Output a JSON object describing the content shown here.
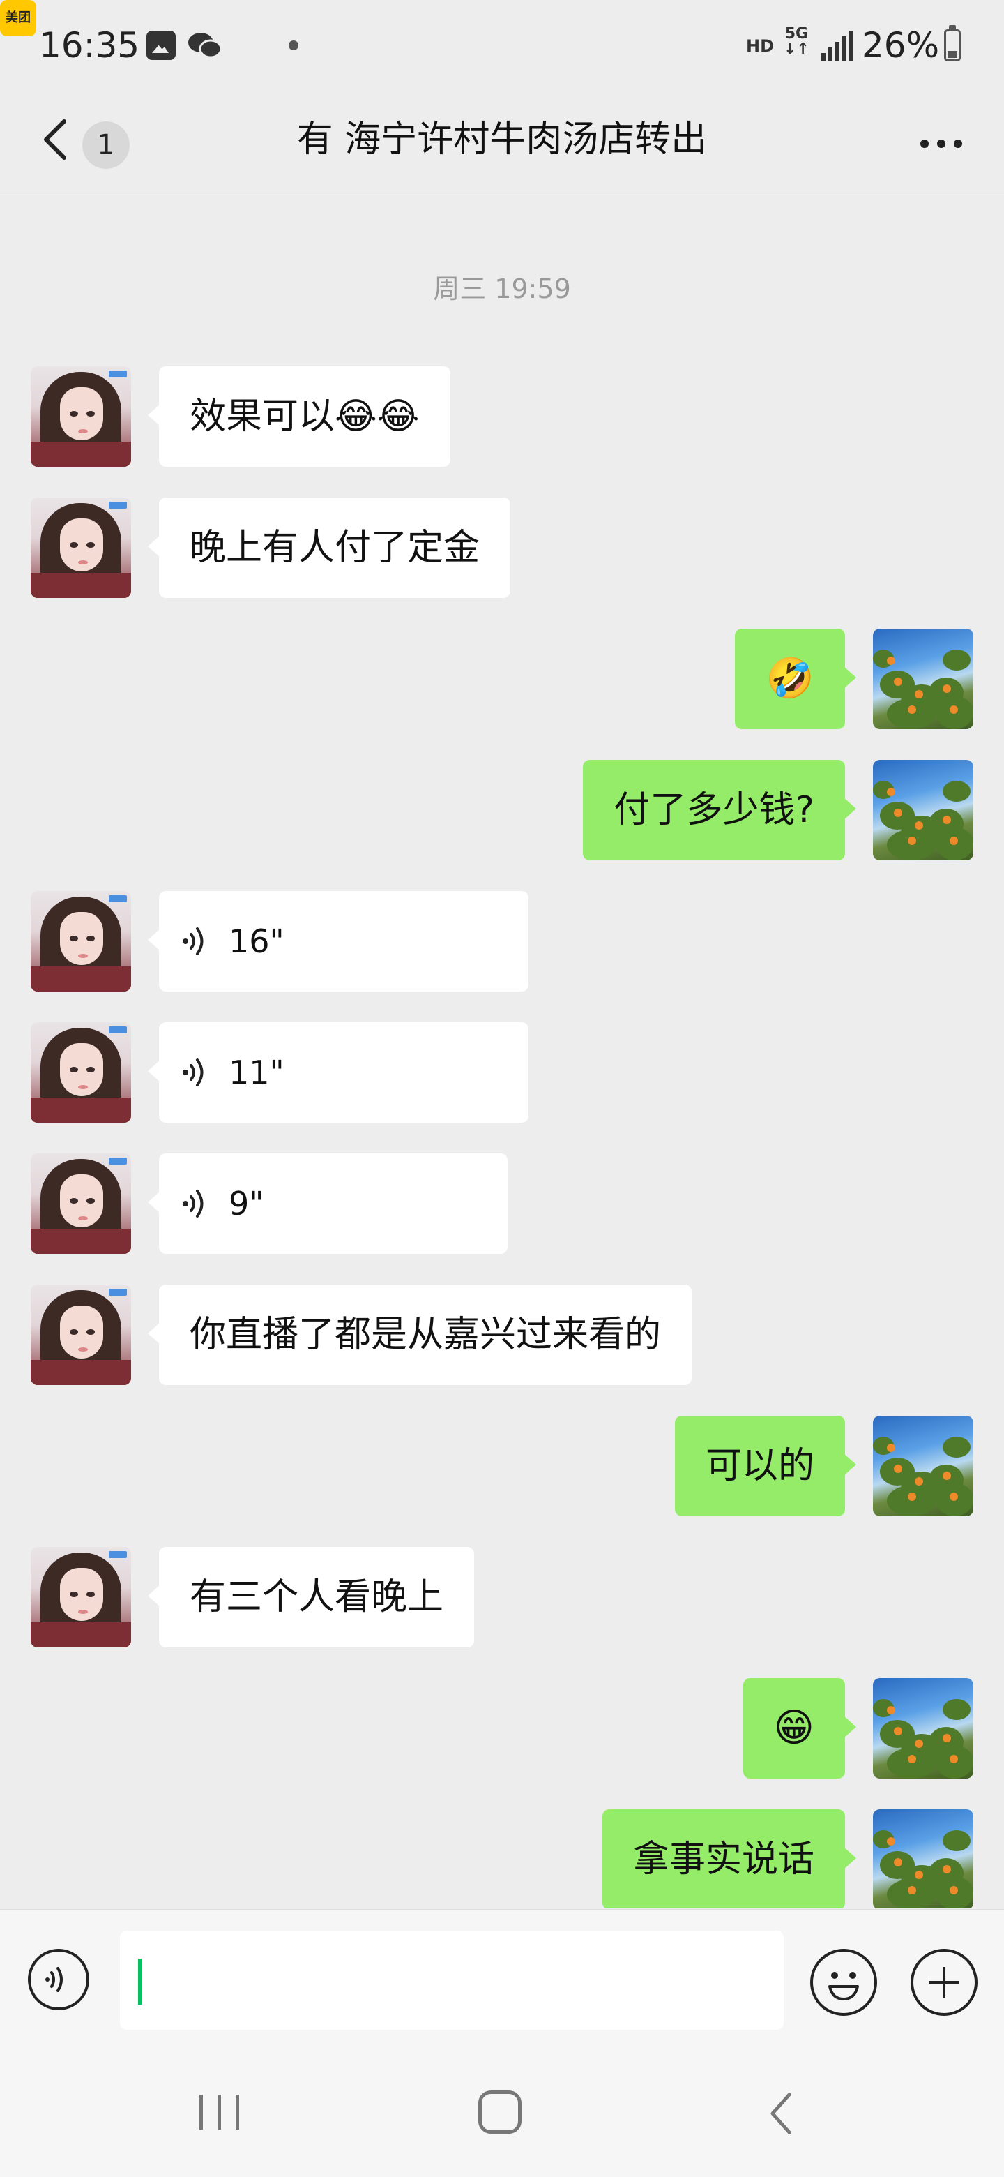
{
  "status_bar": {
    "time": "16:35",
    "meituan_label": "美团",
    "network_hd": "HD",
    "network_5g": "5G",
    "battery_percent": "26%",
    "battery_level": 0.26
  },
  "nav": {
    "back_badge": "1",
    "title": "有 海宁许村牛肉汤店转出"
  },
  "chat": {
    "timestamp": "周三 19:59",
    "messages": [
      {
        "side": "left",
        "type": "text",
        "text": "效果可以😂😂"
      },
      {
        "side": "left",
        "type": "text",
        "text": "晚上有人付了定金"
      },
      {
        "side": "right",
        "type": "emoji",
        "text": "🤣"
      },
      {
        "side": "right",
        "type": "text",
        "text": "付了多少钱?"
      },
      {
        "side": "left",
        "type": "voice",
        "text": "16\""
      },
      {
        "side": "left",
        "type": "voice",
        "text": "11\""
      },
      {
        "side": "left",
        "type": "voice",
        "text": "9\""
      },
      {
        "side": "left",
        "type": "text",
        "text": "你直播了都是从嘉兴过来看的"
      },
      {
        "side": "right",
        "type": "text",
        "text": "可以的"
      },
      {
        "side": "left",
        "type": "text",
        "text": "有三个人看晚上"
      },
      {
        "side": "right",
        "type": "emoji",
        "text": "😁"
      },
      {
        "side": "right",
        "type": "text",
        "text": "拿事实说话"
      }
    ]
  },
  "input": {
    "value": ""
  },
  "colors": {
    "background": "#ededed",
    "bubble_self": "#95ec69",
    "bubble_other": "#ffffff",
    "cursor": "#07c160"
  }
}
